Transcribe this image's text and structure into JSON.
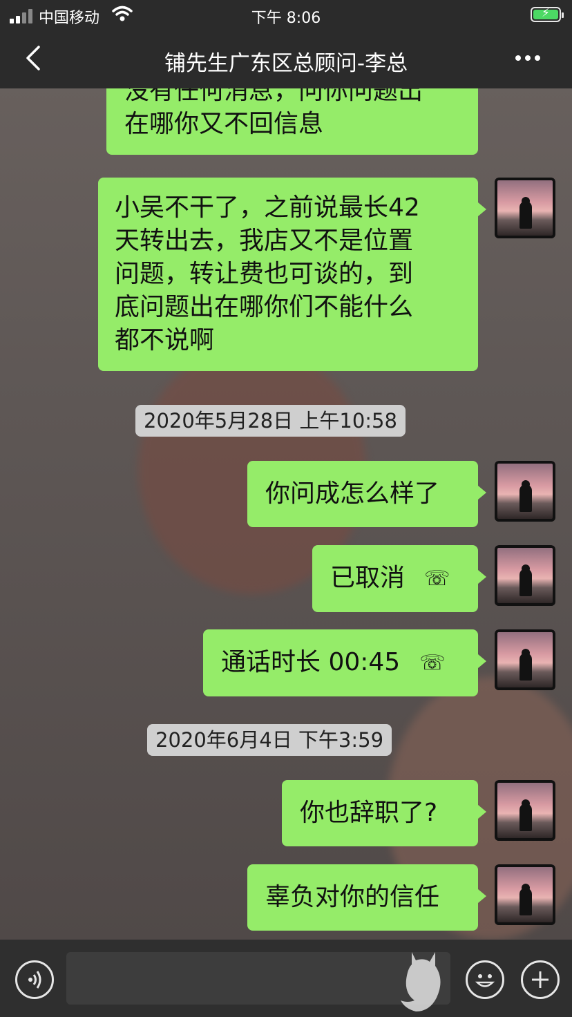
{
  "status_bar": {
    "carrier": "中国移动",
    "time": "下午 8:06"
  },
  "nav": {
    "title": "铺先生广东区总顾问-李总",
    "back_icon": "chevron-left-icon",
    "more_icon": "ellipsis-icon"
  },
  "messages": [
    {
      "type": "text",
      "text": "没有任何消息，问你问题出\n在哪你又不回信息"
    },
    {
      "type": "text",
      "text": "小吴不干了，之前说最长42\n天转出去，我店又不是位置\n问题，转让费也可谈的，到\n底问题出在哪你们不能什么\n都不说啊"
    },
    {
      "type": "timestamp",
      "text": "2020年5月28日 上午10:58"
    },
    {
      "type": "text",
      "text": "你问成怎么样了"
    },
    {
      "type": "call",
      "text": "已取消"
    },
    {
      "type": "call",
      "text": "通话时长 00:45"
    },
    {
      "type": "timestamp",
      "text": "2020年6月4日 下午3:59"
    },
    {
      "type": "text",
      "text": "你也辞职了?"
    },
    {
      "type": "text",
      "text": "辜负对你的信任"
    }
  ],
  "input_bar": {
    "voice_icon": "voice-icon",
    "emoji_icon": "emoji-icon",
    "plus_icon": "plus-icon"
  },
  "colors": {
    "bubble": "#95ec69",
    "bar": "#2b2b2b",
    "timestamp_bg": "#cfcfcf"
  }
}
